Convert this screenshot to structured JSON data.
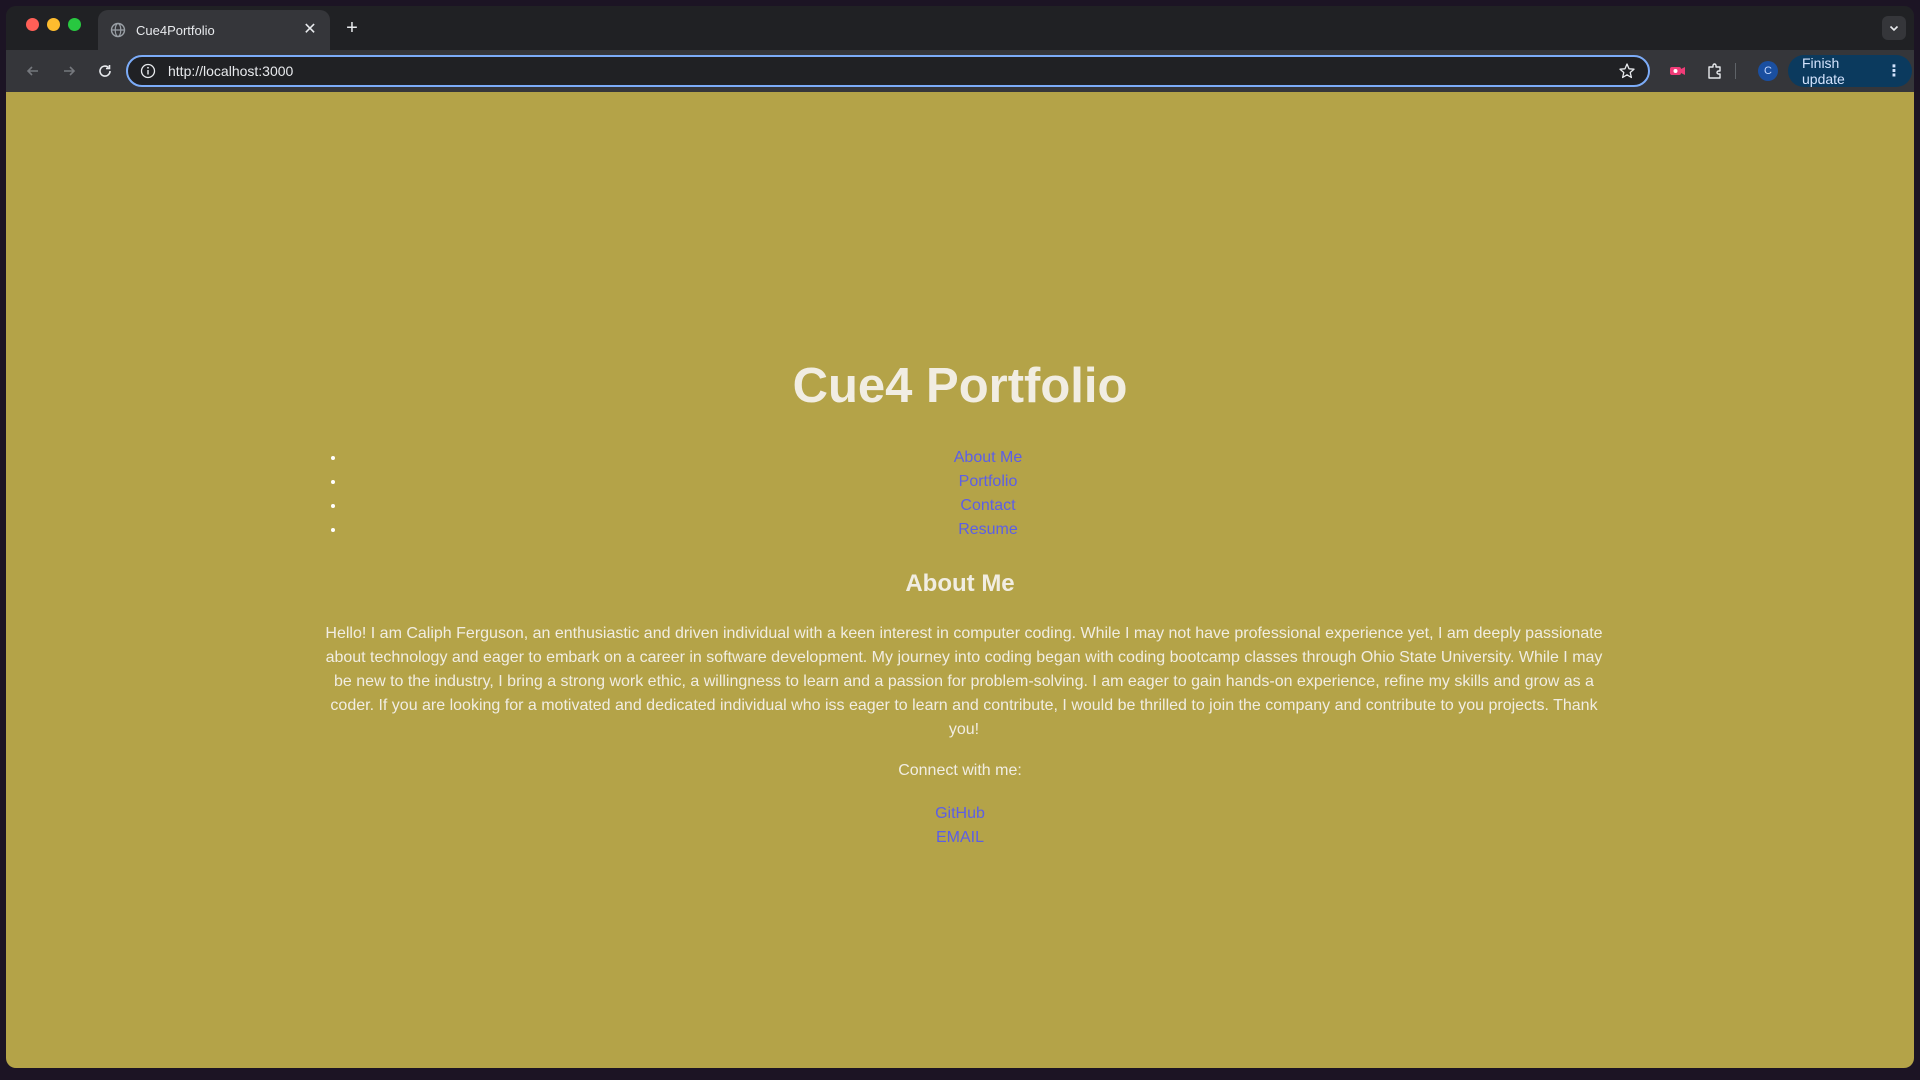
{
  "browser": {
    "tab_title": "Cue4Portfolio",
    "url": "http://localhost:3000",
    "profile_initial": "C",
    "update_label": "Finish update",
    "colors": {
      "frame": "#202124",
      "toolbar": "#35363a",
      "omnibox_focus": "#7cacf8"
    }
  },
  "page": {
    "background": "#b4a348",
    "title": "Cue4 Portfolio",
    "nav": [
      {
        "label": "About Me"
      },
      {
        "label": "Portfolio"
      },
      {
        "label": "Contact"
      },
      {
        "label": "Resume"
      }
    ],
    "about": {
      "heading": "About Me",
      "text": "Hello! I am Caliph Ferguson, an enthusiastic and driven individual with a keen interest in computer coding. While I may not have professional experience yet, I am deeply passionate about technology and eager to embark on a career in software development. My journey into coding began with coding bootcamp classes through Ohio State University. While I may be new to the industry, I bring a strong work ethic, a willingness to learn and a passion for problem-solving. I am eager to gain hands-on experience, refine my skills and grow as a coder. If you are looking for a motivated and dedicated individual who iss eager to learn and contribute, I would be thrilled to join the company and contribute to you projects. Thank you!",
      "connect_label": "Connect with me:",
      "links": [
        {
          "label": "GitHub"
        },
        {
          "label": "EMAIL"
        }
      ]
    },
    "link_color": "#5c5fe6"
  }
}
